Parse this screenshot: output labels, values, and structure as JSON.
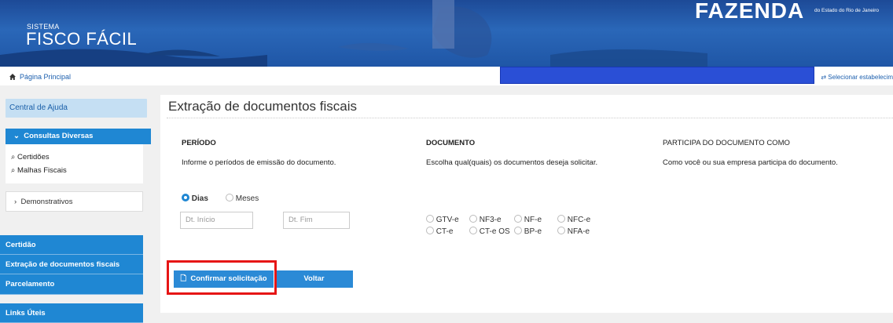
{
  "header": {
    "system_label": "SISTEMA",
    "app_name": "FISCO FÁCIL",
    "brand": "FAZENDA",
    "brand_sub": "do Estado do Rio de Janeiro"
  },
  "breadcrumb": {
    "home": "Página Principal",
    "select_establishment": "Selecionar estabelecim"
  },
  "sidebar": {
    "help": "Central de Ajuda",
    "consultas": {
      "label": "Consultas Diversas",
      "items": [
        "Certidões",
        "Malhas Fiscais"
      ]
    },
    "demonstrativos": "Demonstrativos",
    "links": [
      "Certidão",
      "Extração de documentos fiscais",
      "Parcelamento"
    ],
    "useful_links": "Links Úteis"
  },
  "main": {
    "title": "Extração de documentos fiscais",
    "periodo": {
      "header": "PERÍODO",
      "desc": "Informe o períodos de emissão do documento.",
      "options": [
        "Dias",
        "Meses"
      ],
      "selected": "Dias",
      "start_placeholder": "Dt. Início",
      "end_placeholder": "Dt. Fim"
    },
    "documento": {
      "header": "DOCUMENTO",
      "desc": "Escolha qual(quais) os documentos deseja solicitar.",
      "types": [
        "GTV-e",
        "NF3-e",
        "NF-e",
        "NFC-e",
        "CT-e",
        "CT-e OS",
        "BP-e",
        "NFA-e"
      ]
    },
    "participa": {
      "header": "PARTICIPA DO DOCUMENTO COMO",
      "desc": "Como você ou sua empresa participa do documento."
    },
    "buttons": {
      "confirm": "Confirmar solicitação",
      "back": "Voltar"
    }
  },
  "colors": {
    "accent": "#1f87d3",
    "highlight": "#e61515",
    "redaction": "#2a4fd6"
  }
}
